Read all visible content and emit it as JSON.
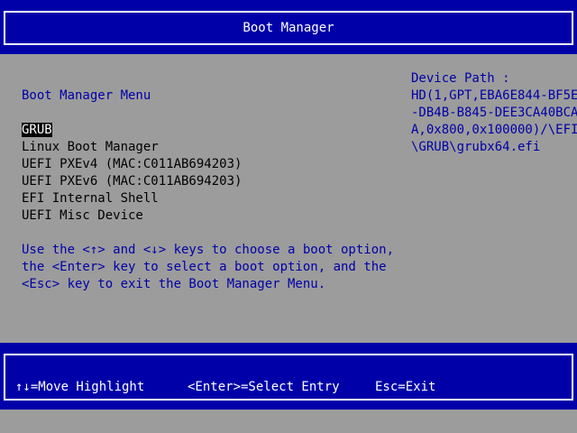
{
  "header": {
    "title": "Boot Manager"
  },
  "menu": {
    "title": "Boot Manager Menu",
    "items": [
      {
        "label": "GRUB",
        "selected": true
      },
      {
        "label": "Linux Boot Manager"
      },
      {
        "label": "UEFI PXEv4 (MAC:C011AB694203)"
      },
      {
        "label": "UEFI PXEv6 (MAC:C011AB694203)"
      },
      {
        "label": "EFI Internal Shell"
      },
      {
        "label": "UEFI Misc Device"
      }
    ]
  },
  "help": {
    "lines": [
      "Use the <↑> and <↓> keys to choose a boot option,",
      "the <Enter> key to select a boot option, and the",
      "<Esc> key to exit the Boot Manager Menu."
    ]
  },
  "device_path": {
    "label": "Device Path :",
    "lines": [
      "HD(1,GPT,EBA6E844-BF5E",
      "-DB4B-B845-DEE3CA40BCA",
      "A,0x800,0x100000)/\\EFI",
      "\\GRUB\\grubx64.efi"
    ]
  },
  "footer": {
    "move": "↑↓=Move Highlight",
    "select": "<Enter>=Select Entry",
    "exit": "Esc=Exit"
  },
  "colors": {
    "background": "#9c9c9c",
    "bar": "#0000a8",
    "text_blue": "#0000a8",
    "text_black": "#000000",
    "highlight_bg": "#000000",
    "highlight_fg": "#ffffff"
  }
}
